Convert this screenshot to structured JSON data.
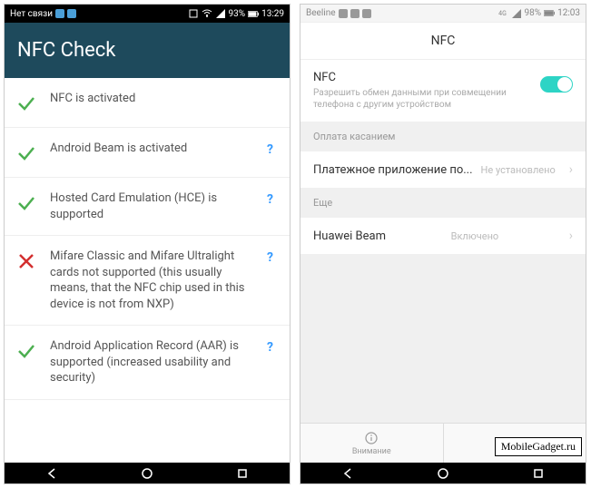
{
  "left": {
    "statusbar": {
      "carrier": "Нет связи",
      "battery": "93%",
      "time": "13:29"
    },
    "header_title": "NFC Check",
    "items": [
      {
        "status": "ok",
        "text": "NFC is activated",
        "help": false
      },
      {
        "status": "ok",
        "text": "Android Beam is activated",
        "help": true
      },
      {
        "status": "ok",
        "text": "Hosted Card Emulation (HCE) is supported",
        "help": true
      },
      {
        "status": "fail",
        "text": "Mifare Classic and Mifare Ultralight cards not supported (this usually means, that the NFC chip used in this device is not from NXP)",
        "help": true
      },
      {
        "status": "ok",
        "text": "Android Application Record (AAR) is supported (increased usability and security)",
        "help": true
      }
    ]
  },
  "right": {
    "statusbar": {
      "carrier": "Beeline",
      "battery": "98%",
      "time": "12:03"
    },
    "header_title": "NFC",
    "nfc_row": {
      "title": "NFC",
      "subtitle": "Разрешить обмен данными при совмещении телефона с другим устройством",
      "toggle": true
    },
    "section_pay": "Оплата касанием",
    "payment_row": {
      "label": "Платежное приложение по...",
      "value": "Не установлено"
    },
    "section_more": "Еще",
    "beam_row": {
      "label": "Huawei Beam",
      "value": "Включено"
    },
    "tabs": {
      "attention": "Внимание",
      "menu": ""
    }
  },
  "watermark": "MobileGadget.ru"
}
